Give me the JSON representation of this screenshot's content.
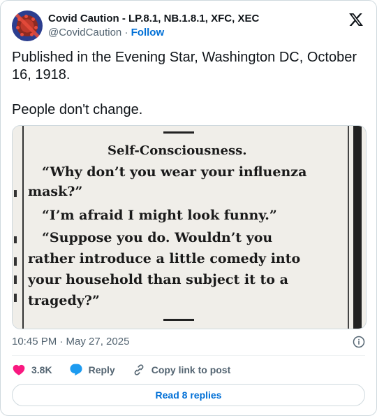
{
  "author": {
    "display_name": "Covid Caution - LP.8.1, NB.1.8.1, XFC, XEC",
    "handle": "@CovidCaution",
    "separator": "·",
    "follow_label": "Follow"
  },
  "tweet": {
    "text_line1": "Published in the Evening Star, Washington DC, October 16, 1918.",
    "text_line2": "People don't change."
  },
  "clipping": {
    "title": "Self-Consciousness.",
    "lines": [
      "“Why don’t you wear your influenza",
      "mask?”",
      "“I’m afraid I might look funny.”",
      "“Suppose   you   do.   Wouldn’t   you",
      "rather introduce a little comedy into",
      "your household than subject it to a",
      "tragedy?”"
    ]
  },
  "meta": {
    "timestamp": "10:45 PM · May 27, 2025"
  },
  "actions": {
    "like_count": "3.8K",
    "reply_label": "Reply",
    "copy_label": "Copy link to post"
  },
  "read_replies_label": "Read 8 replies",
  "colors": {
    "like": "#f91880",
    "link": "#006fd6",
    "reply": "#1d9bf0"
  }
}
